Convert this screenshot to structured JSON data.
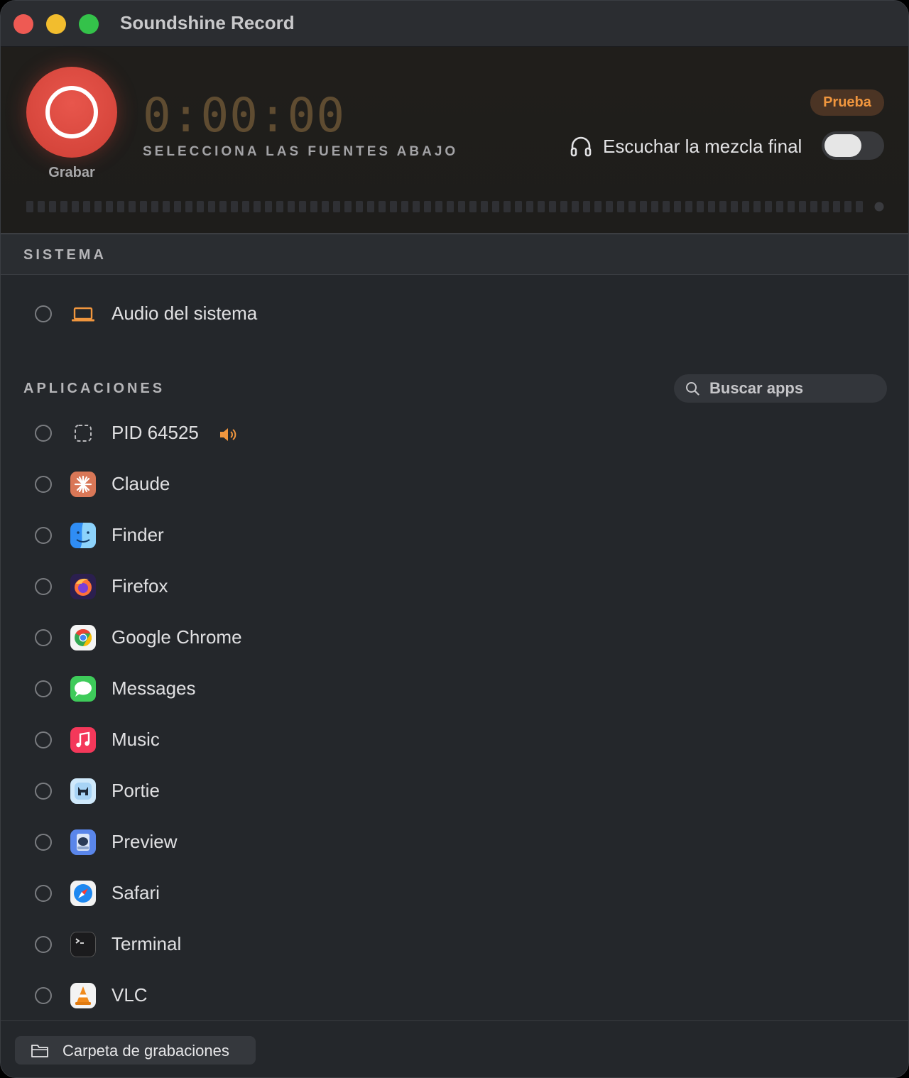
{
  "window": {
    "title": "Soundshine Record"
  },
  "recorder": {
    "record_label": "Grabar",
    "timer": "0:00:00",
    "hint": "SELECCIONA LAS FUENTES ABAJO",
    "badge": "Prueba",
    "listen_label": "Escuchar la mezcla final",
    "listen_enabled": false
  },
  "sections": {
    "system_label": "SISTEMA",
    "apps_label": "APLICACIONES"
  },
  "system": {
    "source": {
      "label": "Audio del sistema",
      "icon": "laptop-icon",
      "selected": false
    }
  },
  "search": {
    "placeholder": "Buscar apps"
  },
  "apps": [
    {
      "label": "PID 64525",
      "icon": "dashed-square-icon",
      "playing": true,
      "selected": false
    },
    {
      "label": "Claude",
      "icon": "claude-icon",
      "selected": false
    },
    {
      "label": "Finder",
      "icon": "finder-icon",
      "selected": false
    },
    {
      "label": "Firefox",
      "icon": "firefox-icon",
      "selected": false
    },
    {
      "label": "Google Chrome",
      "icon": "chrome-icon",
      "selected": false
    },
    {
      "label": "Messages",
      "icon": "messages-icon",
      "selected": false
    },
    {
      "label": "Music",
      "icon": "music-icon",
      "selected": false
    },
    {
      "label": "Portie",
      "icon": "portie-icon",
      "selected": false
    },
    {
      "label": "Preview",
      "icon": "preview-icon",
      "selected": false
    },
    {
      "label": "Safari",
      "icon": "safari-icon",
      "selected": false
    },
    {
      "label": "Terminal",
      "icon": "terminal-icon",
      "selected": false
    },
    {
      "label": "VLC",
      "icon": "vlc-icon",
      "selected": false
    }
  ],
  "footer": {
    "folder_label": "Carpeta de grabaciones"
  },
  "colors": {
    "accent": "#f0963e",
    "record": "#e0473d",
    "timer": "#5f4c31",
    "background": "#24272b"
  }
}
